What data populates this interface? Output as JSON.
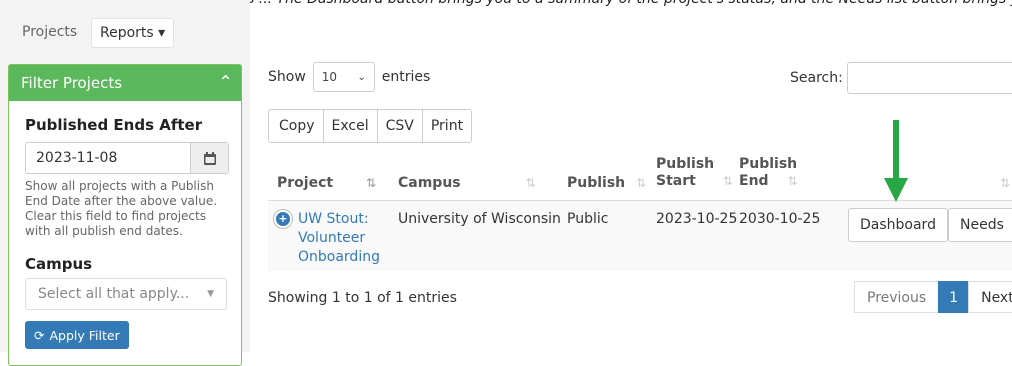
{
  "caption": "This page lists all published projects ... The Dashboard button brings you to a summary of the project's status, and the Needs list button brings you to the Needs list for that project.",
  "nav": {
    "projects_label": "Projects",
    "reports_label": "Reports ▾"
  },
  "filter": {
    "title": "Filter Projects",
    "published_ends_after": {
      "label": "Published Ends After",
      "value": "2023-11-08",
      "help": "Show all projects with a Publish End Date after the above value. Clear this field to find projects with all publish end dates."
    },
    "campus": {
      "label": "Campus",
      "placeholder": "Select all that apply..."
    },
    "apply_label": "Apply Filter"
  },
  "table_controls": {
    "show_label": "Show",
    "entries_value": "10",
    "entries_label": "entries",
    "search_label": "Search:",
    "export_buttons": [
      "Copy",
      "Excel",
      "CSV",
      "Print"
    ]
  },
  "table": {
    "headers": {
      "project": "Project",
      "campus": "Campus",
      "publish": "Publish",
      "publish_start_line1": "Publish",
      "publish_start_line2": "Start",
      "publish_end_line1": "Publish",
      "publish_end_line2": "End"
    },
    "rows": [
      {
        "project_lines": [
          "UW Stout:",
          "Volunteer",
          "Onboarding"
        ],
        "campus": "University of Wisconsin",
        "publish": "Public",
        "publish_start": "2023-10-25",
        "publish_end": "2030-10-25",
        "actions": [
          "Dashboard",
          "Needs"
        ]
      }
    ]
  },
  "footer": {
    "info": "Showing 1 to 1 of 1 entries",
    "pagination": {
      "previous": "Previous",
      "current": "1",
      "next": "Next"
    }
  },
  "colors": {
    "brand_green": "#5cb85c",
    "arrow_green": "#28a745",
    "primary_blue": "#337ab7"
  }
}
